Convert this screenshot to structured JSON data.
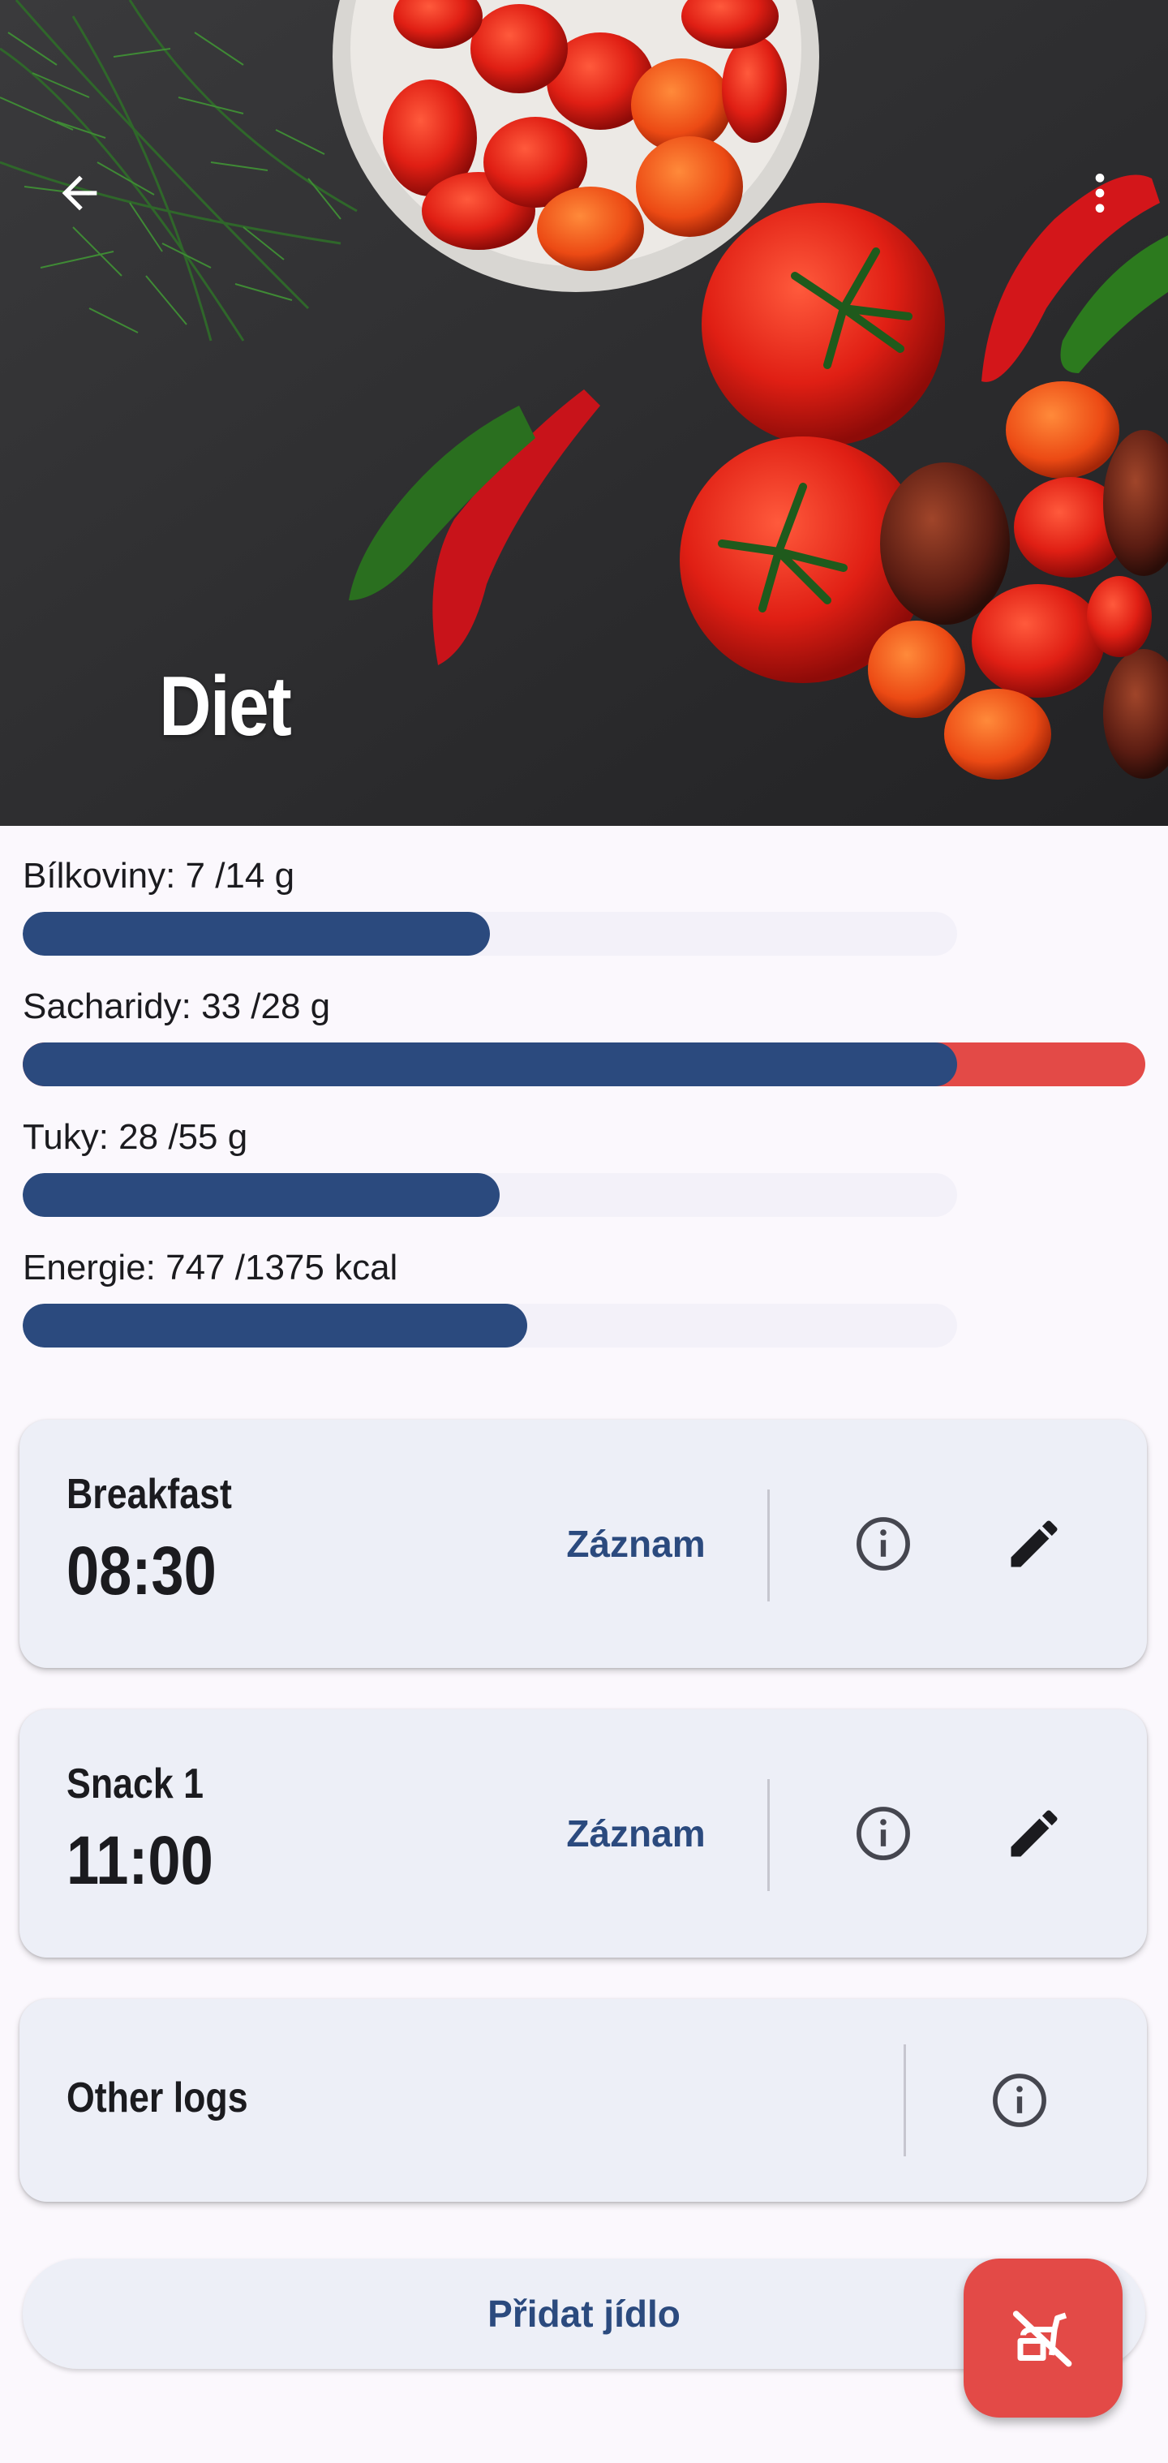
{
  "app": {
    "title": "Diet",
    "back_icon": "arrow-back-icon",
    "more_icon": "more-vertical-icon"
  },
  "nutrients": [
    {
      "label": "Bílkoviny: 7 /14 g",
      "value": 7,
      "target": 14,
      "progress": 0.5,
      "over": false
    },
    {
      "label": "Sacharidy: 33 /28 g",
      "value": 33,
      "target": 28,
      "progress": 1.18,
      "over": true
    },
    {
      "label": "Tuky: 28 /55 g",
      "value": 28,
      "target": 55,
      "progress": 0.51,
      "over": false
    },
    {
      "label": "Energie: 747 /1375 kcal",
      "value": 747,
      "target": 1375,
      "progress": 0.54,
      "over": false
    }
  ],
  "meals": [
    {
      "name": "Breakfast",
      "time": "08:30",
      "log_label": "Záznam"
    },
    {
      "name": "Snack 1",
      "time": "11:00",
      "log_label": "Záznam"
    }
  ],
  "other_logs": {
    "label": "Other logs"
  },
  "add_meal": {
    "label": "Přidat jídlo"
  },
  "fab": {
    "icon": "no-food-icon"
  },
  "colors": {
    "primary": "#2b4a7e",
    "over": "#e34a47",
    "card": "#edeff7",
    "background": "#fbf8fd"
  }
}
